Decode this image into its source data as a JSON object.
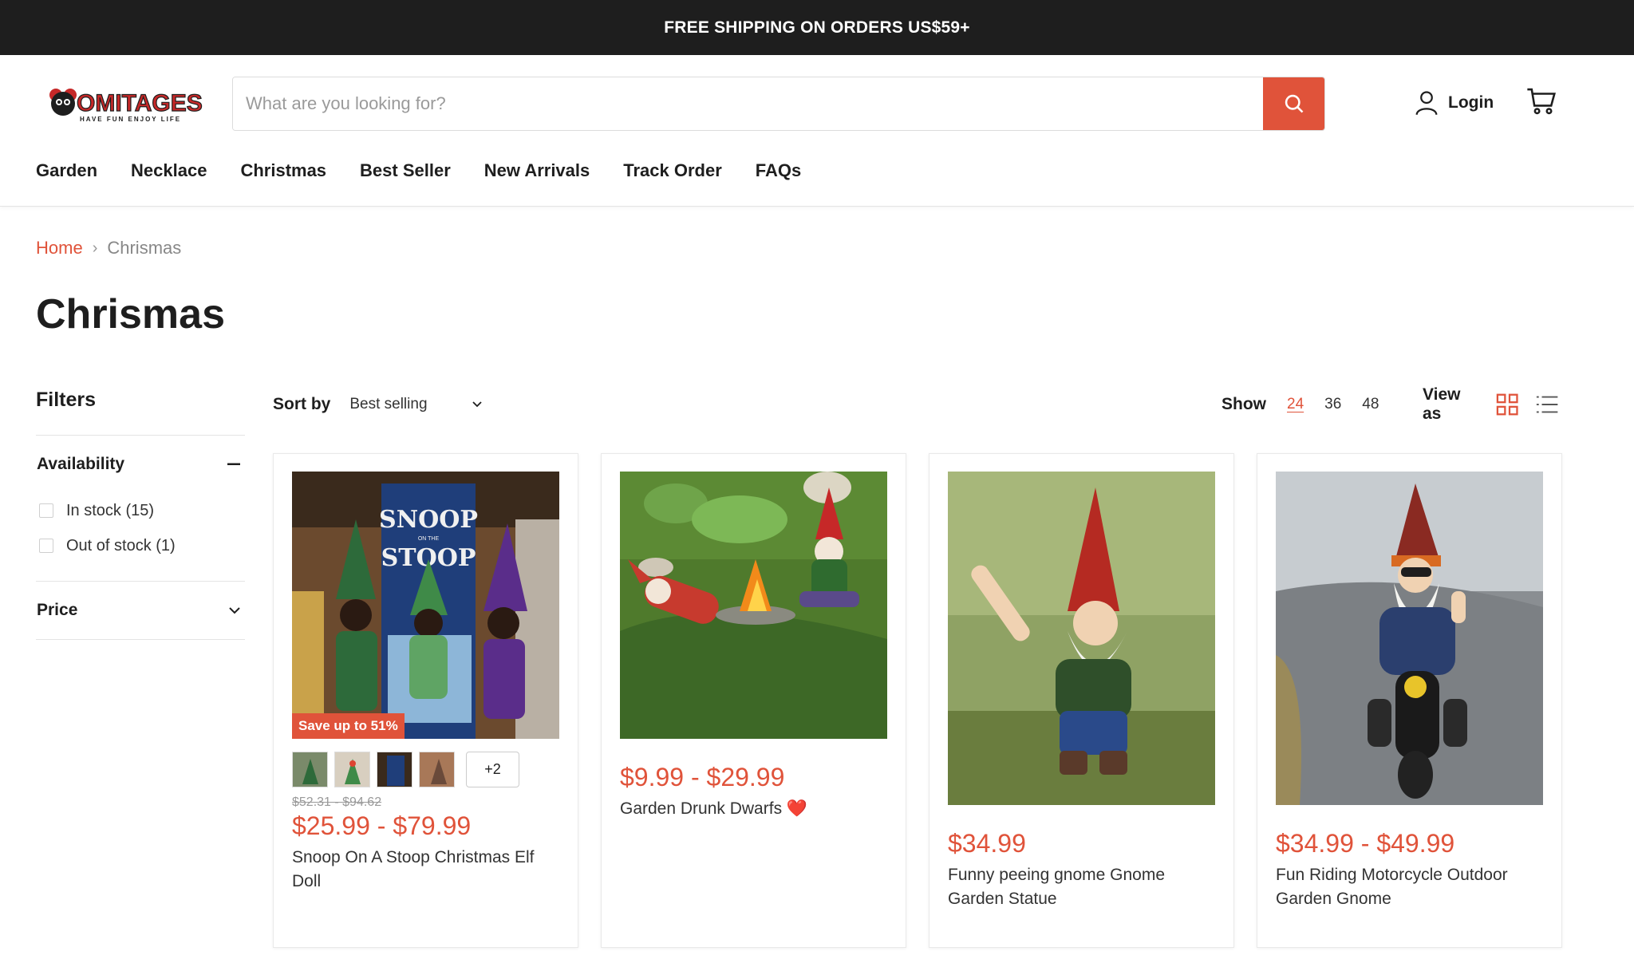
{
  "announcement": "FREE SHIPPING ON ORDERS US$59+",
  "header": {
    "logo_text": "OMITAGES",
    "logo_tagline": "HAVE FUN ENJOY LIFE",
    "search_placeholder": "What are you looking for?",
    "login_label": "Login"
  },
  "nav": [
    "Garden",
    "Necklace",
    "Christmas",
    "Best Seller",
    "New Arrivals",
    "Track Order",
    "FAQs"
  ],
  "breadcrumb": {
    "home": "Home",
    "current": "Chrismas"
  },
  "page_title": "Chrismas",
  "filters": {
    "title": "Filters",
    "availability": {
      "label": "Availability",
      "options": [
        "In stock (15)",
        "Out of stock (1)"
      ]
    },
    "price": {
      "label": "Price"
    }
  },
  "toolbar": {
    "sort_label": "Sort by",
    "sort_value": "Best selling",
    "show_label": "Show",
    "show_options": [
      "24",
      "36",
      "48"
    ],
    "show_active": "24",
    "view_label": "View as"
  },
  "products": [
    {
      "name": "Snoop On A Stoop Christmas Elf Doll",
      "price": "$25.99 - $79.99",
      "compare_price": "$52.31 - $94.62",
      "badge": "Save up to 51%",
      "swatches_more": "+2",
      "box_text": "SNOOP",
      "box_text2": "STOOP",
      "box_text_small": "ON THE"
    },
    {
      "name": "Garden Drunk Dwarfs ❤️",
      "price": "$9.99 - $29.99"
    },
    {
      "name": "Funny peeing gnome Gnome Garden Statue",
      "price": "$34.99"
    },
    {
      "name": "Fun Riding Motorcycle Outdoor Garden Gnome",
      "price": "$34.99 - $49.99"
    }
  ],
  "colors": {
    "accent": "#e0533a",
    "dark": "#1e1e1e"
  }
}
